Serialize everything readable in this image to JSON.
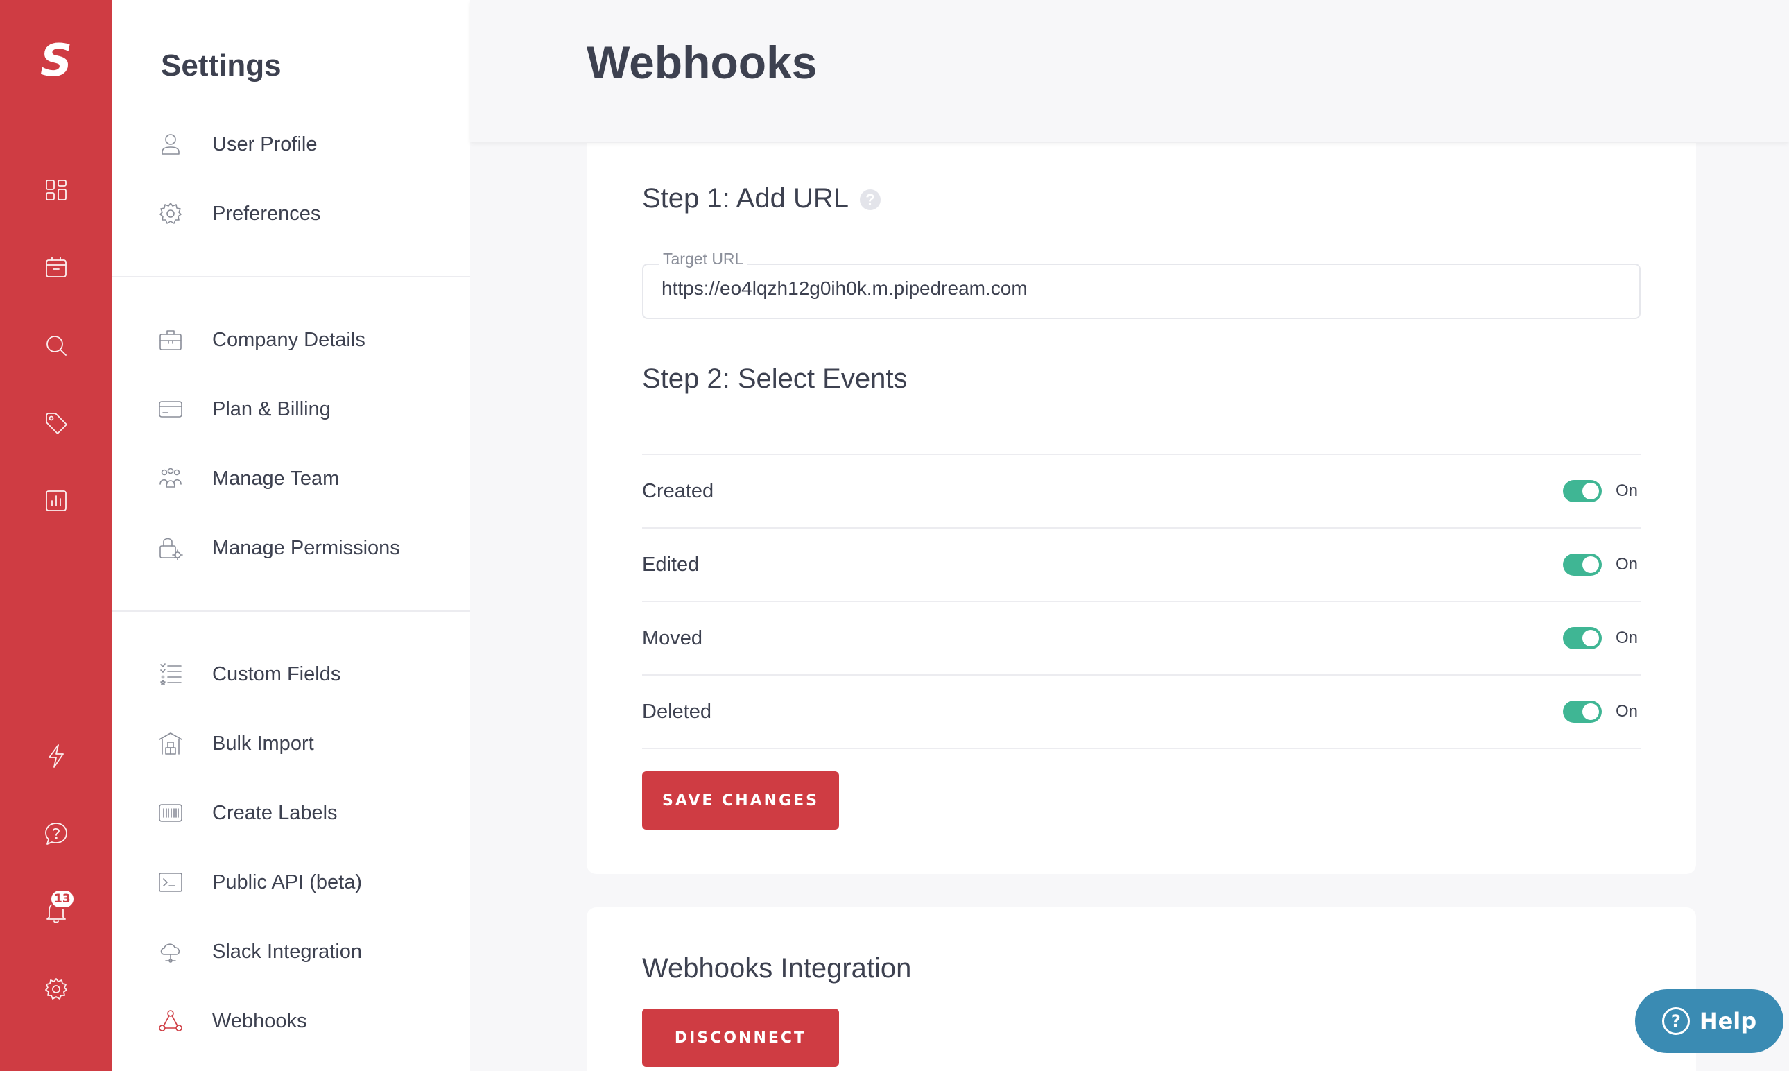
{
  "rail": {
    "logo": "S",
    "notifications_count": "13"
  },
  "sidebar": {
    "title": "Settings",
    "groups": [
      {
        "items": [
          {
            "label": "User Profile",
            "icon": "user-icon"
          },
          {
            "label": "Preferences",
            "icon": "gear-icon"
          }
        ]
      },
      {
        "items": [
          {
            "label": "Company Details",
            "icon": "briefcase-icon"
          },
          {
            "label": "Plan & Billing",
            "icon": "credit-card-icon"
          },
          {
            "label": "Manage Team",
            "icon": "team-icon"
          },
          {
            "label": "Manage Permissions",
            "icon": "lock-gear-icon"
          }
        ]
      },
      {
        "items": [
          {
            "label": "Custom Fields",
            "icon": "list-icon"
          },
          {
            "label": "Bulk Import",
            "icon": "warehouse-icon"
          },
          {
            "label": "Create Labels",
            "icon": "barcode-icon"
          },
          {
            "label": "Public API (beta)",
            "icon": "terminal-icon"
          },
          {
            "label": "Slack Integration",
            "icon": "cloud-icon"
          },
          {
            "label": "Webhooks",
            "icon": "webhook-icon",
            "active": true
          }
        ]
      }
    ]
  },
  "page": {
    "title": "Webhooks"
  },
  "step1": {
    "title": "Step 1: Add URL",
    "help_glyph": "?",
    "url_label": "Target URL",
    "url_value": "https://eo4lqzh12g0ih0k.m.pipedream.com"
  },
  "step2": {
    "title": "Step 2: Select Events",
    "events": [
      {
        "name": "Created",
        "state": "On",
        "enabled": true
      },
      {
        "name": "Edited",
        "state": "On",
        "enabled": true
      },
      {
        "name": "Moved",
        "state": "On",
        "enabled": true
      },
      {
        "name": "Deleted",
        "state": "On",
        "enabled": true
      }
    ],
    "save_label": "SAVE CHANGES"
  },
  "integration": {
    "title": "Webhooks Integration",
    "disconnect_label": "DISCONNECT"
  },
  "help": {
    "label": "Help",
    "glyph": "?"
  },
  "colors": {
    "brand_red": "#cf3c43",
    "toggle_on": "#3fb694",
    "help_blue": "#3a8bb3"
  }
}
